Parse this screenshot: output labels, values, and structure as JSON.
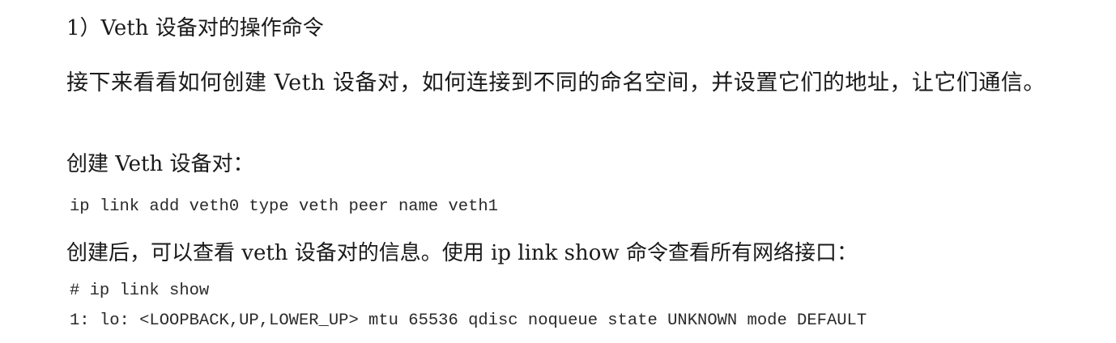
{
  "section": {
    "heading": "1）Veth 设备对的操作命令",
    "intro": "接下来看看如何创建 Veth 设备对，如何连接到不同的命名空间，并设置它们的地址，让它们通信。",
    "create_label": "创建 Veth 设备对：",
    "create_command": "ip link add veth0 type veth peer name veth1",
    "after_create_text": "创建后，可以查看 veth 设备对的信息。使用 ip link show 命令查看所有网络接口：",
    "show_command": "# ip link show",
    "show_output_line1": "1: lo: <LOOPBACK,UP,LOWER_UP> mtu 65536 qdisc noqueue state UNKNOWN mode DEFAULT"
  }
}
